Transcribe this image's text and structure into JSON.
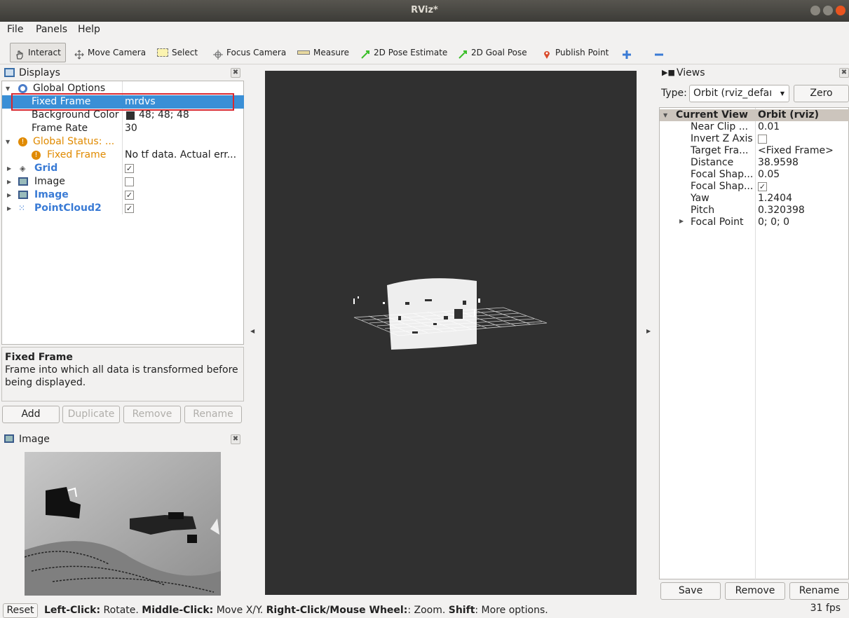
{
  "window": {
    "title": "RViz*"
  },
  "menu": [
    "File",
    "Panels",
    "Help"
  ],
  "toolbar": [
    {
      "label": "Interact",
      "icon": "hand-icon"
    },
    {
      "label": "Move Camera",
      "icon": "move-camera-icon"
    },
    {
      "label": "Select",
      "icon": "select-icon"
    },
    {
      "label": "Focus Camera",
      "icon": "focus-camera-icon"
    },
    {
      "label": "Measure",
      "icon": "ruler-icon"
    },
    {
      "label": "2D Pose Estimate",
      "icon": "pose-arrow-icon"
    },
    {
      "label": "2D Goal Pose",
      "icon": "goal-arrow-icon"
    },
    {
      "label": "Publish Point",
      "icon": "map-pin-icon"
    }
  ],
  "displays": {
    "title": "Displays",
    "rows": [
      {
        "name": "Global Options",
        "value": ""
      },
      {
        "name": "Fixed Frame",
        "value": "mrdvs"
      },
      {
        "name": "Background Color",
        "value": "48; 48; 48"
      },
      {
        "name": "Frame Rate",
        "value": "30"
      },
      {
        "name": "Global Status: ...",
        "value": ""
      },
      {
        "name": "Fixed Frame",
        "value": "No tf data.  Actual err..."
      },
      {
        "name": "Grid",
        "value": "✓"
      },
      {
        "name": "Image",
        "value": ""
      },
      {
        "name": "Image",
        "value": "✓"
      },
      {
        "name": "PointCloud2",
        "value": "✓"
      }
    ],
    "help_title": "Fixed Frame",
    "help_text": "Frame into which all data is transformed before being displayed.",
    "buttons": [
      "Add",
      "Duplicate",
      "Remove",
      "Rename"
    ]
  },
  "image_panel": {
    "title": "Image"
  },
  "views": {
    "title": "Views",
    "type_label": "Type:",
    "type_value": "Orbit (rviz_defaı",
    "zero": "Zero",
    "header": [
      "Current View",
      "Orbit (rviz)"
    ],
    "rows": [
      {
        "name": "Near Clip ...",
        "value": "0.01"
      },
      {
        "name": "Invert Z Axis",
        "value": ""
      },
      {
        "name": "Target Fra...",
        "value": "<Fixed Frame>"
      },
      {
        "name": "Distance",
        "value": "38.9598"
      },
      {
        "name": "Focal Shap...",
        "value": "0.05"
      },
      {
        "name": "Focal Shap...",
        "value": "✓"
      },
      {
        "name": "Yaw",
        "value": "1.2404"
      },
      {
        "name": "Pitch",
        "value": "0.320398"
      },
      {
        "name": "Focal Point",
        "value": "0; 0; 0"
      }
    ],
    "buttons": [
      "Save",
      "Remove",
      "Rename"
    ]
  },
  "status": {
    "reset": "Reset",
    "k1": "Left-Click:",
    "t1": " Rotate. ",
    "k2": "Middle-Click:",
    "t2": " Move X/Y. ",
    "k3": "Right-Click/Mouse Wheel:",
    "t3": ": Zoom. ",
    "k4": "Shift",
    "t4": ": More options.",
    "fps": "31 fps"
  },
  "colors": {
    "link": "#3a7bd5",
    "warn": "#e08a00",
    "select": "#3a8fd6",
    "viewport": "#303030",
    "highlight_box": "#d9282f"
  }
}
